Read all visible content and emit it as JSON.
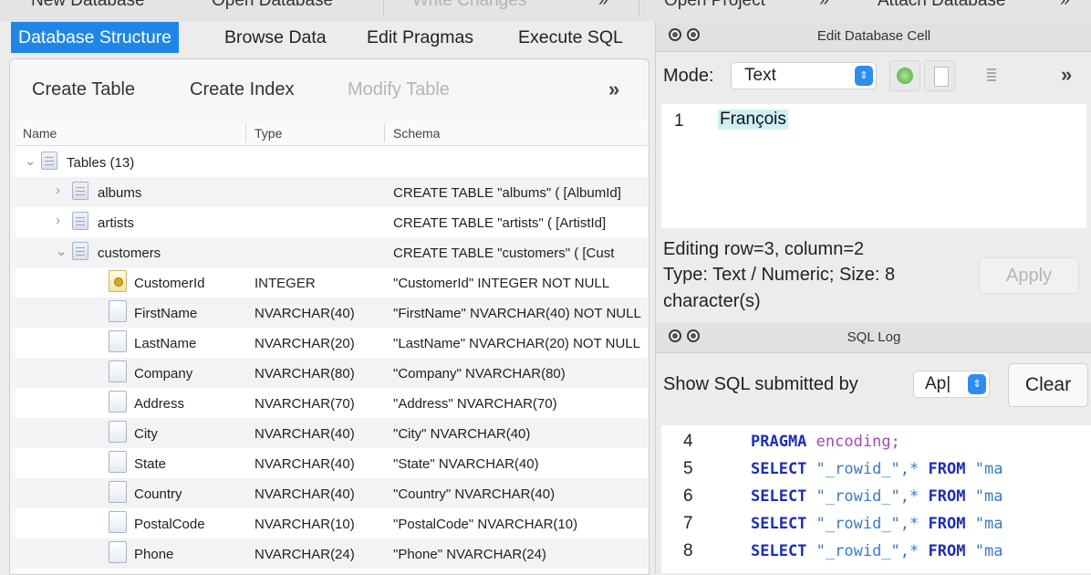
{
  "toolbar": {
    "items": [
      "New Database",
      "Open Database",
      "Write Changes",
      "Open Project",
      "Attach Database"
    ],
    "chevron": "»"
  },
  "tabs": [
    "Database Structure",
    "Browse Data",
    "Edit Pragmas",
    "Execute SQL"
  ],
  "structure_toolbar": {
    "create_table": "Create Table",
    "create_index": "Create Index",
    "modify_table": "Modify Table",
    "more": "»"
  },
  "tree": {
    "headers": [
      "Name",
      "Type",
      "Schema"
    ],
    "rows": [
      {
        "level": 0,
        "icon": "table-group-icon",
        "expand": "open",
        "name": "Tables (13)",
        "type": "",
        "schema": ""
      },
      {
        "level": 1,
        "icon": "table-icon",
        "expand": "closed",
        "name": "albums",
        "type": "",
        "schema": "CREATE TABLE \"albums\" ( [AlbumId]"
      },
      {
        "level": 1,
        "icon": "table-icon",
        "expand": "closed",
        "name": "artists",
        "type": "",
        "schema": "CREATE TABLE \"artists\" ( [ArtistId]"
      },
      {
        "level": 1,
        "icon": "table-icon",
        "expand": "open",
        "name": "customers",
        "type": "",
        "schema": "CREATE TABLE \"customers\" ( [Cust"
      },
      {
        "level": 2,
        "icon": "primary-key-icon",
        "name": "CustomerId",
        "type": "INTEGER",
        "schema": "\"CustomerId\" INTEGER NOT NULL"
      },
      {
        "level": 2,
        "icon": "field-icon",
        "name": "FirstName",
        "type": "NVARCHAR(40)",
        "schema": "\"FirstName\" NVARCHAR(40) NOT NULL"
      },
      {
        "level": 2,
        "icon": "field-icon",
        "name": "LastName",
        "type": "NVARCHAR(20)",
        "schema": "\"LastName\" NVARCHAR(20) NOT NULL"
      },
      {
        "level": 2,
        "icon": "field-icon",
        "name": "Company",
        "type": "NVARCHAR(80)",
        "schema": "\"Company\" NVARCHAR(80)"
      },
      {
        "level": 2,
        "icon": "field-icon",
        "name": "Address",
        "type": "NVARCHAR(70)",
        "schema": "\"Address\" NVARCHAR(70)"
      },
      {
        "level": 2,
        "icon": "field-icon",
        "name": "City",
        "type": "NVARCHAR(40)",
        "schema": "\"City\" NVARCHAR(40)"
      },
      {
        "level": 2,
        "icon": "field-icon",
        "name": "State",
        "type": "NVARCHAR(40)",
        "schema": "\"State\" NVARCHAR(40)"
      },
      {
        "level": 2,
        "icon": "field-icon",
        "name": "Country",
        "type": "NVARCHAR(40)",
        "schema": "\"Country\" NVARCHAR(40)"
      },
      {
        "level": 2,
        "icon": "field-icon",
        "name": "PostalCode",
        "type": "NVARCHAR(10)",
        "schema": "\"PostalCode\" NVARCHAR(10)"
      },
      {
        "level": 2,
        "icon": "field-icon",
        "name": "Phone",
        "type": "NVARCHAR(24)",
        "schema": "\"Phone\" NVARCHAR(24)"
      }
    ]
  },
  "edit_cell": {
    "title": "Edit Database Cell",
    "mode_label": "Mode:",
    "mode_value": "Text",
    "more": "»",
    "line_number": "1",
    "cell_value": "François",
    "status_line1": "Editing row=3, column=2",
    "status_line2": "Type: Text / Numeric; Size: 8",
    "status_line3": "character(s)",
    "apply_label": "Apply"
  },
  "sql_log": {
    "title": "SQL Log",
    "show_label": "Show SQL submitted by",
    "submitter_value": "Ap|",
    "clear_label": "Clear",
    "lines": [
      {
        "n": "4",
        "kw": "PRAGMA",
        "rest": "encoding;",
        "kw2": "",
        "tail": ""
      },
      {
        "n": "5",
        "kw": "SELECT",
        "rest": "\"_rowid_\",*",
        "kw2": "FROM",
        "tail": "\"ma"
      },
      {
        "n": "6",
        "kw": "SELECT",
        "rest": "\"_rowid_\",*",
        "kw2": "FROM",
        "tail": "\"ma"
      },
      {
        "n": "7",
        "kw": "SELECT",
        "rest": "\"_rowid_\",*",
        "kw2": "FROM",
        "tail": "\"ma"
      },
      {
        "n": "8",
        "kw": "SELECT",
        "rest": "\"_rowid_\",*",
        "kw2": "FROM",
        "tail": "\"ma"
      }
    ]
  },
  "colors": {
    "accent": "#1f86e6",
    "keyword": "#1c2fb0",
    "identifier": "#a04bb0"
  }
}
